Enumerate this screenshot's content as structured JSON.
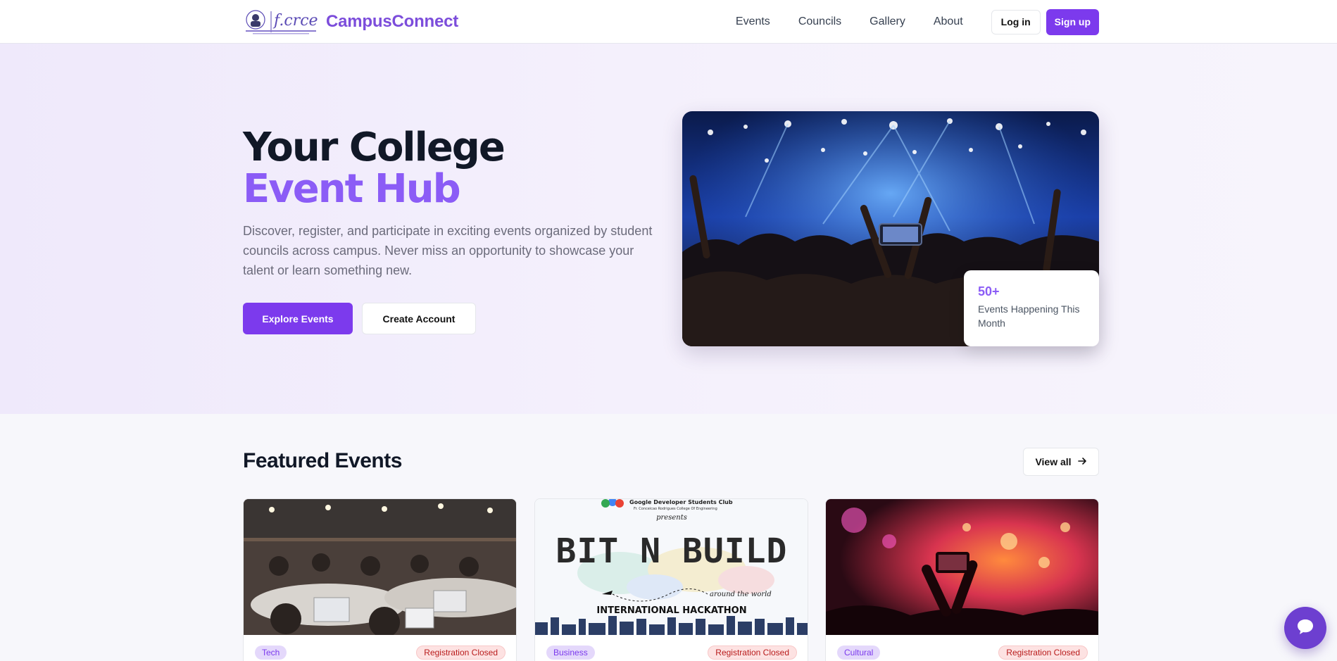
{
  "nav": {
    "brand": "CampusConnect",
    "logo_icon": "college-logo-icon",
    "links": [
      "Events",
      "Councils",
      "Gallery",
      "About"
    ],
    "login_label": "Log in",
    "signup_label": "Sign up"
  },
  "hero": {
    "title_line1": "Your College",
    "title_line2": "Event Hub",
    "description": "Discover, register, and participate in exciting events organized by student councils across campus. Never miss an opportunity to showcase your talent or learn something new.",
    "explore_label": "Explore Events",
    "create_label": "Create Account",
    "stat_number": "50+",
    "stat_label": "Events Happening This Month"
  },
  "featured": {
    "title": "Featured Events",
    "view_all_label": "View all",
    "cards": [
      {
        "category": "Tech",
        "status": "Registration Closed"
      },
      {
        "category": "Business",
        "status": "Registration Closed"
      },
      {
        "category": "Cultural",
        "status": "Registration Closed"
      }
    ]
  },
  "poster": {
    "org": "Google Developer Students Club",
    "college": "Fr. Conceicao Rodrigues College Of Engineering",
    "presents": "presents",
    "title": "BIT N BUILD",
    "subtitle": "around the world",
    "tagline": "INTERNATIONAL HACKATHON"
  },
  "colors": {
    "accent": "#7c3aed",
    "accent_light": "#8b5cf6",
    "status_red": "#b91c1c"
  },
  "icons": {
    "view_all": "arrow-right-icon",
    "chat": "chat-bubble-icon"
  }
}
